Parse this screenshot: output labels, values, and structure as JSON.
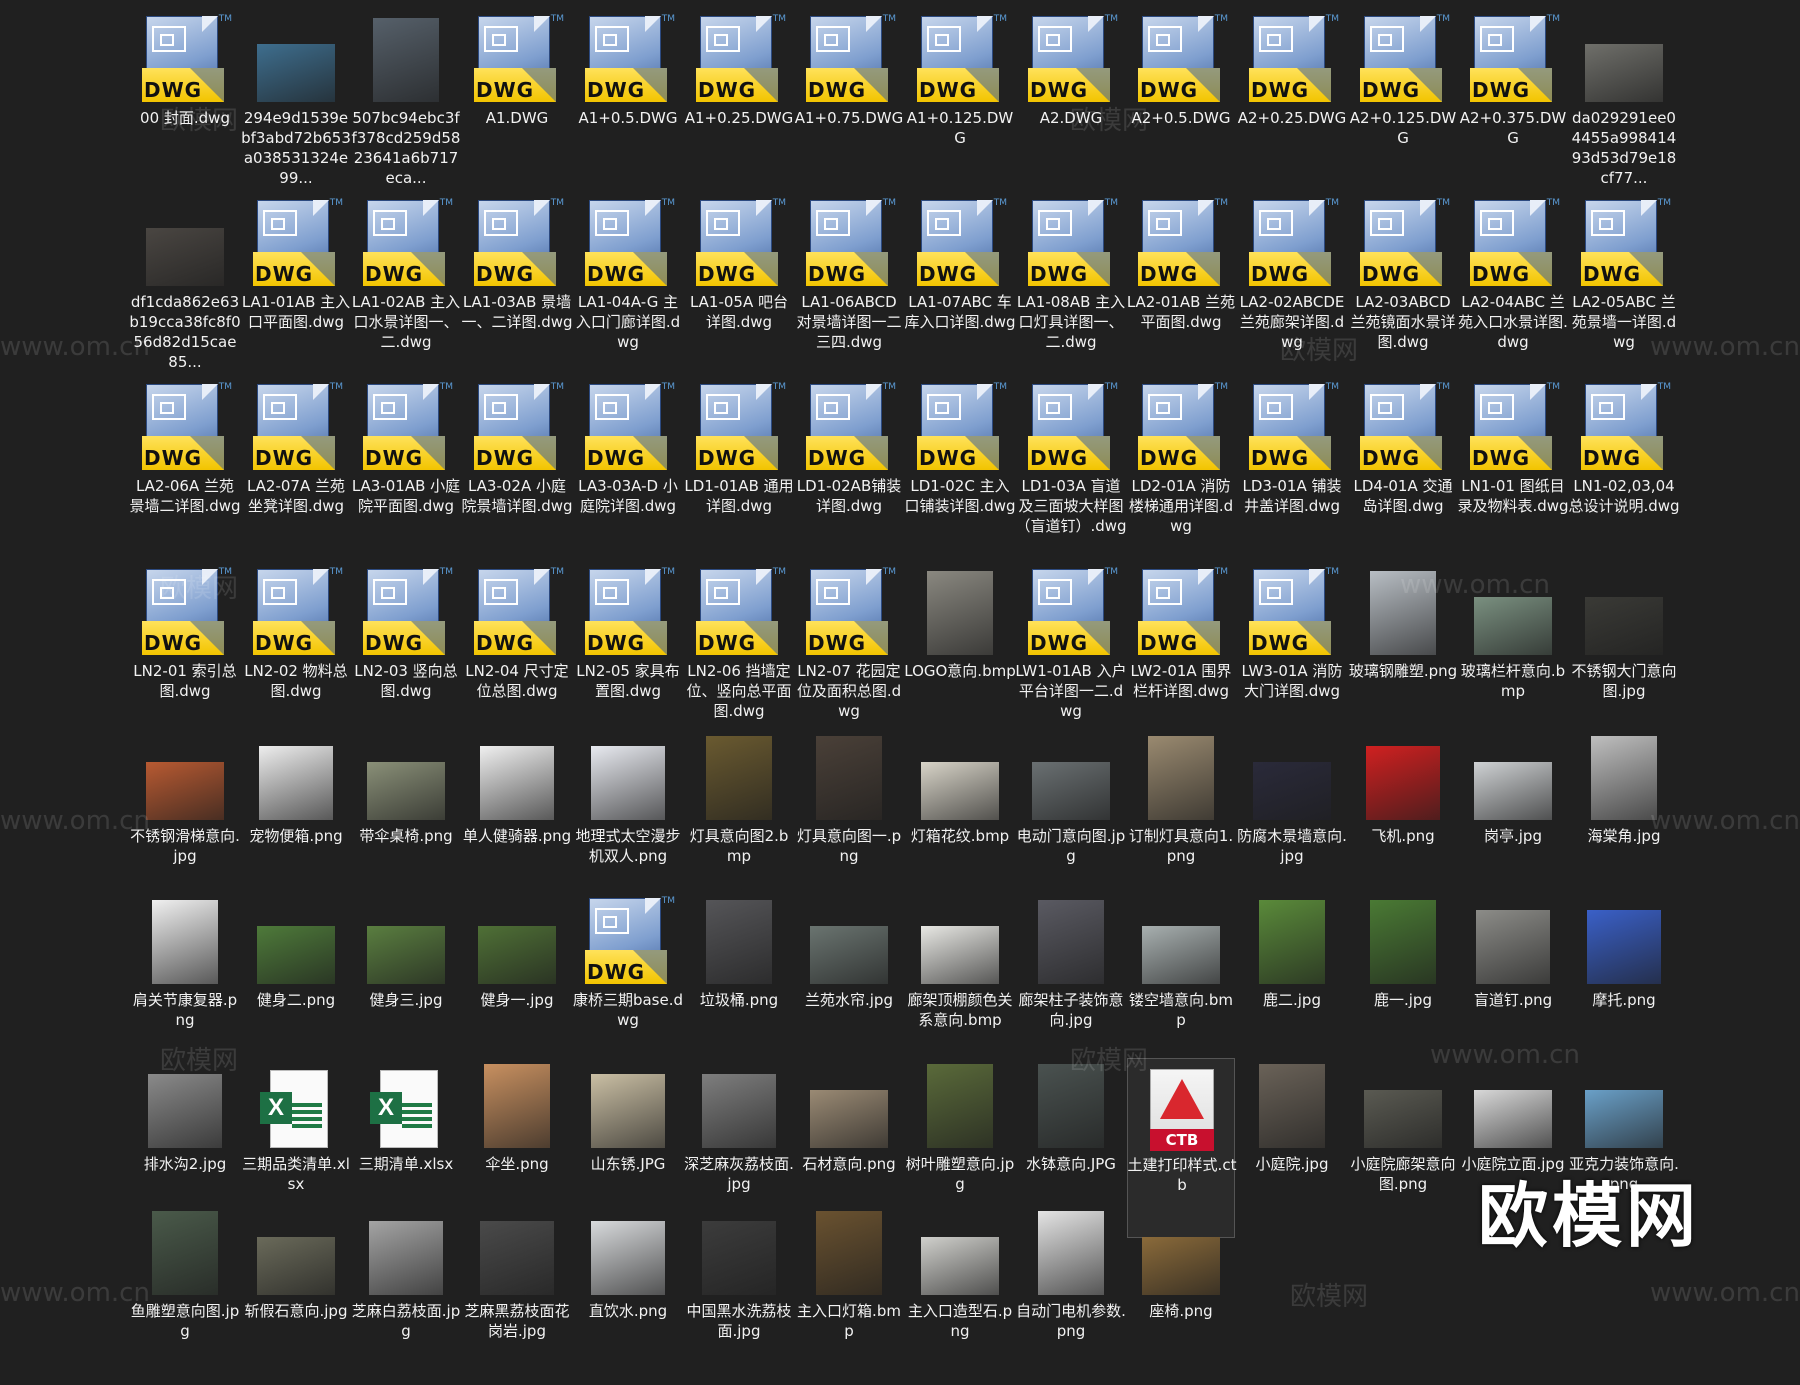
{
  "files": [
    {
      "name": "00 封面.dwg",
      "type": "dwg"
    },
    {
      "name": "294e9d1539ebf3abd72b653a038531324e99...",
      "type": "image",
      "color": "#3e6e8e"
    },
    {
      "name": "507bc94ebc3ff378cd259d5823641a6b717eca...",
      "type": "image",
      "color": "#56606a",
      "shape": "tall"
    },
    {
      "name": "A1.DWG",
      "type": "dwg"
    },
    {
      "name": "A1+0.5.DWG",
      "type": "dwg"
    },
    {
      "name": "A1+0.25.DWG",
      "type": "dwg"
    },
    {
      "name": "A1+0.75.DWG",
      "type": "dwg"
    },
    {
      "name": "A1+0.125.DWG",
      "type": "dwg"
    },
    {
      "name": "A2.DWG",
      "type": "dwg"
    },
    {
      "name": "A2+0.5.DWG",
      "type": "dwg"
    },
    {
      "name": "A2+0.25.DWG",
      "type": "dwg"
    },
    {
      "name": "A2+0.125.DWG",
      "type": "dwg"
    },
    {
      "name": "A2+0.375.DWG",
      "type": "dwg"
    },
    {
      "name": "da029291ee04455a99841493d53d79e18cf77...",
      "type": "image",
      "color": "#6f6f6a"
    },
    {
      "name": "df1cda862e63b19cca38fc8f056d82d15cae85...",
      "type": "image",
      "color": "#4a4642"
    },
    {
      "name": "LA1-01AB 主入口平面图.dwg",
      "type": "dwg"
    },
    {
      "name": "LA1-02AB 主入口水景详图一、二.dwg",
      "type": "dwg"
    },
    {
      "name": "LA1-03AB 景墙一、二详图.dwg",
      "type": "dwg"
    },
    {
      "name": "LA1-04A-G 主入口门廊详图.dwg",
      "type": "dwg"
    },
    {
      "name": "LA1-05A 吧台详图.dwg",
      "type": "dwg"
    },
    {
      "name": "LA1-06ABCD 对景墙详图一二三四.dwg",
      "type": "dwg"
    },
    {
      "name": "LA1-07ABC 车库入口详图.dwg",
      "type": "dwg"
    },
    {
      "name": "LA1-08AB 主入口灯具详图一、二.dwg",
      "type": "dwg"
    },
    {
      "name": "LA2-01AB 兰苑平面图.dwg",
      "type": "dwg"
    },
    {
      "name": "LA2-02ABCDE 兰苑廊架详图.dwg",
      "type": "dwg"
    },
    {
      "name": "LA2-03ABCD 兰苑镜面水景详图.dwg",
      "type": "dwg"
    },
    {
      "name": "LA2-04ABC 兰苑入口水景详图.dwg",
      "type": "dwg"
    },
    {
      "name": "LA2-05ABC 兰苑景墙一详图.dwg",
      "type": "dwg"
    },
    {
      "name": "LA2-06A 兰苑景墙二详图.dwg",
      "type": "dwg"
    },
    {
      "name": "LA2-07A 兰苑坐凳详图.dwg",
      "type": "dwg"
    },
    {
      "name": "LA3-01AB 小庭院平面图.dwg",
      "type": "dwg"
    },
    {
      "name": "LA3-02A 小庭院景墙详图.dwg",
      "type": "dwg"
    },
    {
      "name": "LA3-03A-D 小庭院详图.dwg",
      "type": "dwg"
    },
    {
      "name": "LD1-01AB 通用详图.dwg",
      "type": "dwg"
    },
    {
      "name": "LD1-02AB铺装详图.dwg",
      "type": "dwg"
    },
    {
      "name": "LD1-02C 主入口铺装详图.dwg",
      "type": "dwg"
    },
    {
      "name": "LD1-03A 盲道及三面坡大样图（盲道钉）.dwg",
      "type": "dwg"
    },
    {
      "name": "LD2-01A 消防楼梯通用详图.dwg",
      "type": "dwg"
    },
    {
      "name": "LD3-01A 铺装井盖详图.dwg",
      "type": "dwg"
    },
    {
      "name": "LD4-01A 交通岛详图.dwg",
      "type": "dwg"
    },
    {
      "name": "LN1-01 图纸目录及物料表.dwg",
      "type": "dwg"
    },
    {
      "name": "LN1-02,03,04 总设计说明.dwg",
      "type": "dwg"
    },
    {
      "name": "LN2-01 索引总图.dwg",
      "type": "dwg"
    },
    {
      "name": "LN2-02 物料总图.dwg",
      "type": "dwg"
    },
    {
      "name": "LN2-03 竖向总图.dwg",
      "type": "dwg"
    },
    {
      "name": "LN2-04 尺寸定位总图.dwg",
      "type": "dwg"
    },
    {
      "name": "LN2-05 家具布置图.dwg",
      "type": "dwg"
    },
    {
      "name": "LN2-06 挡墙定位、竖向总平面图.dwg",
      "type": "dwg"
    },
    {
      "name": "LN2-07 花园定位及面积总图.dwg",
      "type": "dwg"
    },
    {
      "name": "LOGO意向.bmp",
      "type": "image",
      "color": "#8a8880",
      "shape": "tall"
    },
    {
      "name": "LW1-01AB 入户平台详图一二.dwg",
      "type": "dwg"
    },
    {
      "name": "LW2-01A 围界栏杆详图.dwg",
      "type": "dwg"
    },
    {
      "name": "LW3-01A 消防大门详图.dwg",
      "type": "dwg"
    },
    {
      "name": "玻璃钢雕塑.png",
      "type": "image",
      "color": "#b8bec4",
      "shape": "tall"
    },
    {
      "name": "玻璃栏杆意向.bmp",
      "type": "image",
      "color": "#7a9080"
    },
    {
      "name": "不锈钢大门意向图.jpg",
      "type": "image",
      "color": "#3a3a36"
    },
    {
      "name": "不锈钢滑梯意向.jpg",
      "type": "image",
      "color": "#b85a32"
    },
    {
      "name": "宠物便箱.png",
      "type": "image",
      "color": "#eeeeee",
      "shape": "square"
    },
    {
      "name": "带伞桌椅.png",
      "type": "image",
      "color": "#8a9078"
    },
    {
      "name": "单人健骑器.png",
      "type": "image",
      "color": "#f0f0f0",
      "shape": "square"
    },
    {
      "name": "地理式太空漫步机双人.png",
      "type": "image",
      "color": "#e8eaf0",
      "shape": "square"
    },
    {
      "name": "灯具意向图2.bmp",
      "type": "image",
      "color": "#6a5a30",
      "shape": "tall"
    },
    {
      "name": "灯具意向图一.png",
      "type": "image",
      "color": "#4a4038",
      "shape": "tall"
    },
    {
      "name": "灯箱花纹.bmp",
      "type": "image",
      "color": "#d8d4c8"
    },
    {
      "name": "电动门意向图.jpg",
      "type": "image",
      "color": "#6a7072"
    },
    {
      "name": "订制灯具意向1.png",
      "type": "image",
      "color": "#9a8a70",
      "shape": "tall"
    },
    {
      "name": "防腐木景墙意向.jpg",
      "type": "image",
      "color": "#2a2a3a"
    },
    {
      "name": "飞机.png",
      "type": "image",
      "color": "#d02020",
      "shape": "square"
    },
    {
      "name": "岗亭.jpg",
      "type": "image",
      "color": "#cfd2d4"
    },
    {
      "name": "海棠角.jpg",
      "type": "image",
      "color": "#bfbfbf",
      "shape": "tall"
    },
    {
      "name": "肩关节康复器.png",
      "type": "image",
      "color": "#f0f0f0",
      "shape": "tall"
    },
    {
      "name": "健身二.png",
      "type": "image",
      "color": "#4e7a3a"
    },
    {
      "name": "健身三.jpg",
      "type": "image",
      "color": "#5a7e40"
    },
    {
      "name": "健身一.jpg",
      "type": "image",
      "color": "#4f7036"
    },
    {
      "name": "康桥三期base.dwg",
      "type": "dwg"
    },
    {
      "name": "垃圾桶.png",
      "type": "image",
      "color": "#555558",
      "shape": "tall"
    },
    {
      "name": "兰苑水帘.jpg",
      "type": "image",
      "color": "#6a7470"
    },
    {
      "name": "廊架顶棚颜色关系意向.bmp",
      "type": "image",
      "color": "#e8e8e4"
    },
    {
      "name": "廊架柱子装饰意向.jpg",
      "type": "image",
      "color": "#5a5a62",
      "shape": "tall"
    },
    {
      "name": "镂空墙意向.bmp",
      "type": "image",
      "color": "#a8b0b0"
    },
    {
      "name": "鹿二.jpg",
      "type": "image",
      "color": "#5a8a3a",
      "shape": "tall"
    },
    {
      "name": "鹿一.jpg",
      "type": "image",
      "color": "#4a7a34",
      "shape": "tall"
    },
    {
      "name": "盲道钉.png",
      "type": "image",
      "color": "#8c8c88",
      "shape": "square"
    },
    {
      "name": "摩托.png",
      "type": "image",
      "color": "#3a60c8",
      "shape": "square"
    },
    {
      "name": "排水沟2.jpg",
      "type": "image",
      "color": "#8a8a8a",
      "shape": "square"
    },
    {
      "name": "三期品类清单.xlsx",
      "type": "xlsx"
    },
    {
      "name": "三期清单.xlsx",
      "type": "xlsx"
    },
    {
      "name": "伞坐.png",
      "type": "image",
      "color": "#c89060",
      "shape": "tall"
    },
    {
      "name": "山东锈.JPG",
      "type": "image",
      "color": "#cabfa4",
      "shape": "square"
    },
    {
      "name": "深芝麻灰荔枝面.jpg",
      "type": "image",
      "color": "#7e7e7e",
      "shape": "square"
    },
    {
      "name": "石材意向.png",
      "type": "image",
      "color": "#9a8a74"
    },
    {
      "name": "树叶雕塑意向.jpg",
      "type": "image",
      "color": "#5a6a3a",
      "shape": "tall"
    },
    {
      "name": "水钵意向.JPG",
      "type": "image",
      "color": "#4a5250",
      "shape": "tall"
    },
    {
      "name": "土建打印样式.ctb",
      "type": "ctb",
      "selected": true
    },
    {
      "name": "小庭院.jpg",
      "type": "image",
      "color": "#6a6258",
      "shape": "tall"
    },
    {
      "name": "小庭院廊架意向图.png",
      "type": "image",
      "color": "#5a5a52"
    },
    {
      "name": "小庭院立面.jpg",
      "type": "image",
      "color": "#d8d8d8"
    },
    {
      "name": "亚克力装饰意向.png",
      "type": "image",
      "color": "#6aa0c8"
    },
    {
      "name": "鱼雕塑意向图.jpg",
      "type": "image",
      "color": "#4a5a4a",
      "shape": "tall"
    },
    {
      "name": "斩假石意向.jpg",
      "type": "image",
      "color": "#6a6a5a"
    },
    {
      "name": "芝麻白荔枝面.jpg",
      "type": "image",
      "color": "#a4a4a4",
      "shape": "square"
    },
    {
      "name": "芝麻黑荔枝面花岗岩.jpg",
      "type": "image",
      "color": "#4a4a4a",
      "shape": "square"
    },
    {
      "name": "直饮水.png",
      "type": "image",
      "color": "#d8dadc",
      "shape": "square"
    },
    {
      "name": "中国黑水洗荔枝面.jpg",
      "type": "image",
      "color": "#3c3c3c",
      "shape": "square"
    },
    {
      "name": "主入口灯箱.bmp",
      "type": "image",
      "color": "#6a5230",
      "shape": "tall"
    },
    {
      "name": "主入口造型石.png",
      "type": "image",
      "color": "#d0d0cc"
    },
    {
      "name": "自动门电机参数.png",
      "type": "image",
      "color": "#e4e4e4",
      "shape": "tall"
    },
    {
      "name": "座椅.png",
      "type": "image",
      "color": "#8a6a3a"
    }
  ],
  "watermarks": {
    "text1": "欧模网",
    "text2": "www.om.cn",
    "brand": "欧模网"
  },
  "labels": {
    "dwg": "DWG",
    "tm": "TM",
    "ctb": "CTB",
    "xlsx": "X"
  }
}
